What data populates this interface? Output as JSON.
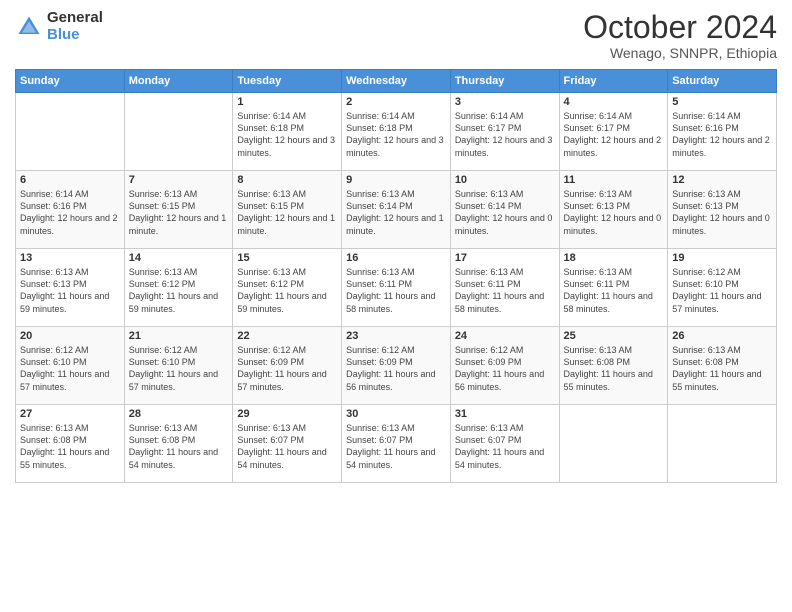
{
  "logo": {
    "general": "General",
    "blue": "Blue"
  },
  "header": {
    "month": "October 2024",
    "location": "Wenago, SNNPR, Ethiopia"
  },
  "weekdays": [
    "Sunday",
    "Monday",
    "Tuesday",
    "Wednesday",
    "Thursday",
    "Friday",
    "Saturday"
  ],
  "weeks": [
    [
      {
        "day": "",
        "info": ""
      },
      {
        "day": "",
        "info": ""
      },
      {
        "day": "1",
        "info": "Sunrise: 6:14 AM\nSunset: 6:18 PM\nDaylight: 12 hours and 3 minutes."
      },
      {
        "day": "2",
        "info": "Sunrise: 6:14 AM\nSunset: 6:18 PM\nDaylight: 12 hours and 3 minutes."
      },
      {
        "day": "3",
        "info": "Sunrise: 6:14 AM\nSunset: 6:17 PM\nDaylight: 12 hours and 3 minutes."
      },
      {
        "day": "4",
        "info": "Sunrise: 6:14 AM\nSunset: 6:17 PM\nDaylight: 12 hours and 2 minutes."
      },
      {
        "day": "5",
        "info": "Sunrise: 6:14 AM\nSunset: 6:16 PM\nDaylight: 12 hours and 2 minutes."
      }
    ],
    [
      {
        "day": "6",
        "info": "Sunrise: 6:14 AM\nSunset: 6:16 PM\nDaylight: 12 hours and 2 minutes."
      },
      {
        "day": "7",
        "info": "Sunrise: 6:13 AM\nSunset: 6:15 PM\nDaylight: 12 hours and 1 minute."
      },
      {
        "day": "8",
        "info": "Sunrise: 6:13 AM\nSunset: 6:15 PM\nDaylight: 12 hours and 1 minute."
      },
      {
        "day": "9",
        "info": "Sunrise: 6:13 AM\nSunset: 6:14 PM\nDaylight: 12 hours and 1 minute."
      },
      {
        "day": "10",
        "info": "Sunrise: 6:13 AM\nSunset: 6:14 PM\nDaylight: 12 hours and 0 minutes."
      },
      {
        "day": "11",
        "info": "Sunrise: 6:13 AM\nSunset: 6:13 PM\nDaylight: 12 hours and 0 minutes."
      },
      {
        "day": "12",
        "info": "Sunrise: 6:13 AM\nSunset: 6:13 PM\nDaylight: 12 hours and 0 minutes."
      }
    ],
    [
      {
        "day": "13",
        "info": "Sunrise: 6:13 AM\nSunset: 6:13 PM\nDaylight: 11 hours and 59 minutes."
      },
      {
        "day": "14",
        "info": "Sunrise: 6:13 AM\nSunset: 6:12 PM\nDaylight: 11 hours and 59 minutes."
      },
      {
        "day": "15",
        "info": "Sunrise: 6:13 AM\nSunset: 6:12 PM\nDaylight: 11 hours and 59 minutes."
      },
      {
        "day": "16",
        "info": "Sunrise: 6:13 AM\nSunset: 6:11 PM\nDaylight: 11 hours and 58 minutes."
      },
      {
        "day": "17",
        "info": "Sunrise: 6:13 AM\nSunset: 6:11 PM\nDaylight: 11 hours and 58 minutes."
      },
      {
        "day": "18",
        "info": "Sunrise: 6:13 AM\nSunset: 6:11 PM\nDaylight: 11 hours and 58 minutes."
      },
      {
        "day": "19",
        "info": "Sunrise: 6:12 AM\nSunset: 6:10 PM\nDaylight: 11 hours and 57 minutes."
      }
    ],
    [
      {
        "day": "20",
        "info": "Sunrise: 6:12 AM\nSunset: 6:10 PM\nDaylight: 11 hours and 57 minutes."
      },
      {
        "day": "21",
        "info": "Sunrise: 6:12 AM\nSunset: 6:10 PM\nDaylight: 11 hours and 57 minutes."
      },
      {
        "day": "22",
        "info": "Sunrise: 6:12 AM\nSunset: 6:09 PM\nDaylight: 11 hours and 57 minutes."
      },
      {
        "day": "23",
        "info": "Sunrise: 6:12 AM\nSunset: 6:09 PM\nDaylight: 11 hours and 56 minutes."
      },
      {
        "day": "24",
        "info": "Sunrise: 6:12 AM\nSunset: 6:09 PM\nDaylight: 11 hours and 56 minutes."
      },
      {
        "day": "25",
        "info": "Sunrise: 6:13 AM\nSunset: 6:08 PM\nDaylight: 11 hours and 55 minutes."
      },
      {
        "day": "26",
        "info": "Sunrise: 6:13 AM\nSunset: 6:08 PM\nDaylight: 11 hours and 55 minutes."
      }
    ],
    [
      {
        "day": "27",
        "info": "Sunrise: 6:13 AM\nSunset: 6:08 PM\nDaylight: 11 hours and 55 minutes."
      },
      {
        "day": "28",
        "info": "Sunrise: 6:13 AM\nSunset: 6:08 PM\nDaylight: 11 hours and 54 minutes."
      },
      {
        "day": "29",
        "info": "Sunrise: 6:13 AM\nSunset: 6:07 PM\nDaylight: 11 hours and 54 minutes."
      },
      {
        "day": "30",
        "info": "Sunrise: 6:13 AM\nSunset: 6:07 PM\nDaylight: 11 hours and 54 minutes."
      },
      {
        "day": "31",
        "info": "Sunrise: 6:13 AM\nSunset: 6:07 PM\nDaylight: 11 hours and 54 minutes."
      },
      {
        "day": "",
        "info": ""
      },
      {
        "day": "",
        "info": ""
      }
    ]
  ]
}
